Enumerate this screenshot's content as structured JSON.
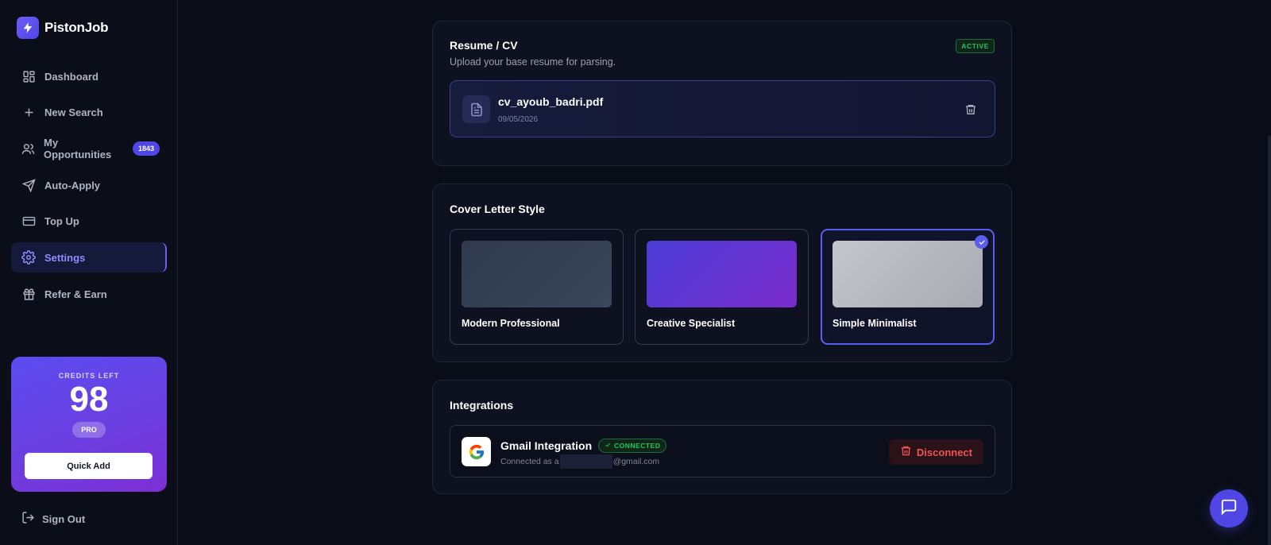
{
  "brand": {
    "name": "PistonJob"
  },
  "sidebar": {
    "items": [
      {
        "label": "Dashboard",
        "icon": "dashboard-icon"
      },
      {
        "label": "New Search",
        "icon": "plus-icon"
      },
      {
        "label": "My Opportunities",
        "icon": "users-icon",
        "badge": "1843"
      },
      {
        "label": "Auto-Apply",
        "icon": "send-icon"
      },
      {
        "label": "Top Up",
        "icon": "credit-card-icon"
      },
      {
        "label": "Settings",
        "icon": "gear-icon",
        "active": true
      },
      {
        "label": "Refer & Earn",
        "icon": "gift-icon"
      }
    ],
    "credits": {
      "label": "CREDITS LEFT",
      "value": "98",
      "plan": "PRO",
      "button": "Quick Add"
    },
    "signout": "Sign Out"
  },
  "resume": {
    "title": "Resume / CV",
    "subtitle": "Upload your base resume for parsing.",
    "badge": "ACTIVE",
    "file": {
      "name": "cv_ayoub_badri.pdf",
      "date": "09/05/2026"
    }
  },
  "cover_letter": {
    "title": "Cover Letter Style",
    "options": [
      {
        "label": "Modern Professional",
        "selected": false
      },
      {
        "label": "Creative Specialist",
        "selected": false
      },
      {
        "label": "Simple Minimalist",
        "selected": true
      }
    ]
  },
  "integrations": {
    "title": "Integrations",
    "gmail": {
      "name": "Gmail Integration",
      "status": "CONNECTED",
      "email_prefix": "Connected as a",
      "email_suffix": "@gmail.com",
      "disconnect_label": "Disconnect"
    }
  },
  "colors": {
    "accent": "#4f46e5",
    "success": "#22c55e",
    "danger": "#f05252"
  }
}
